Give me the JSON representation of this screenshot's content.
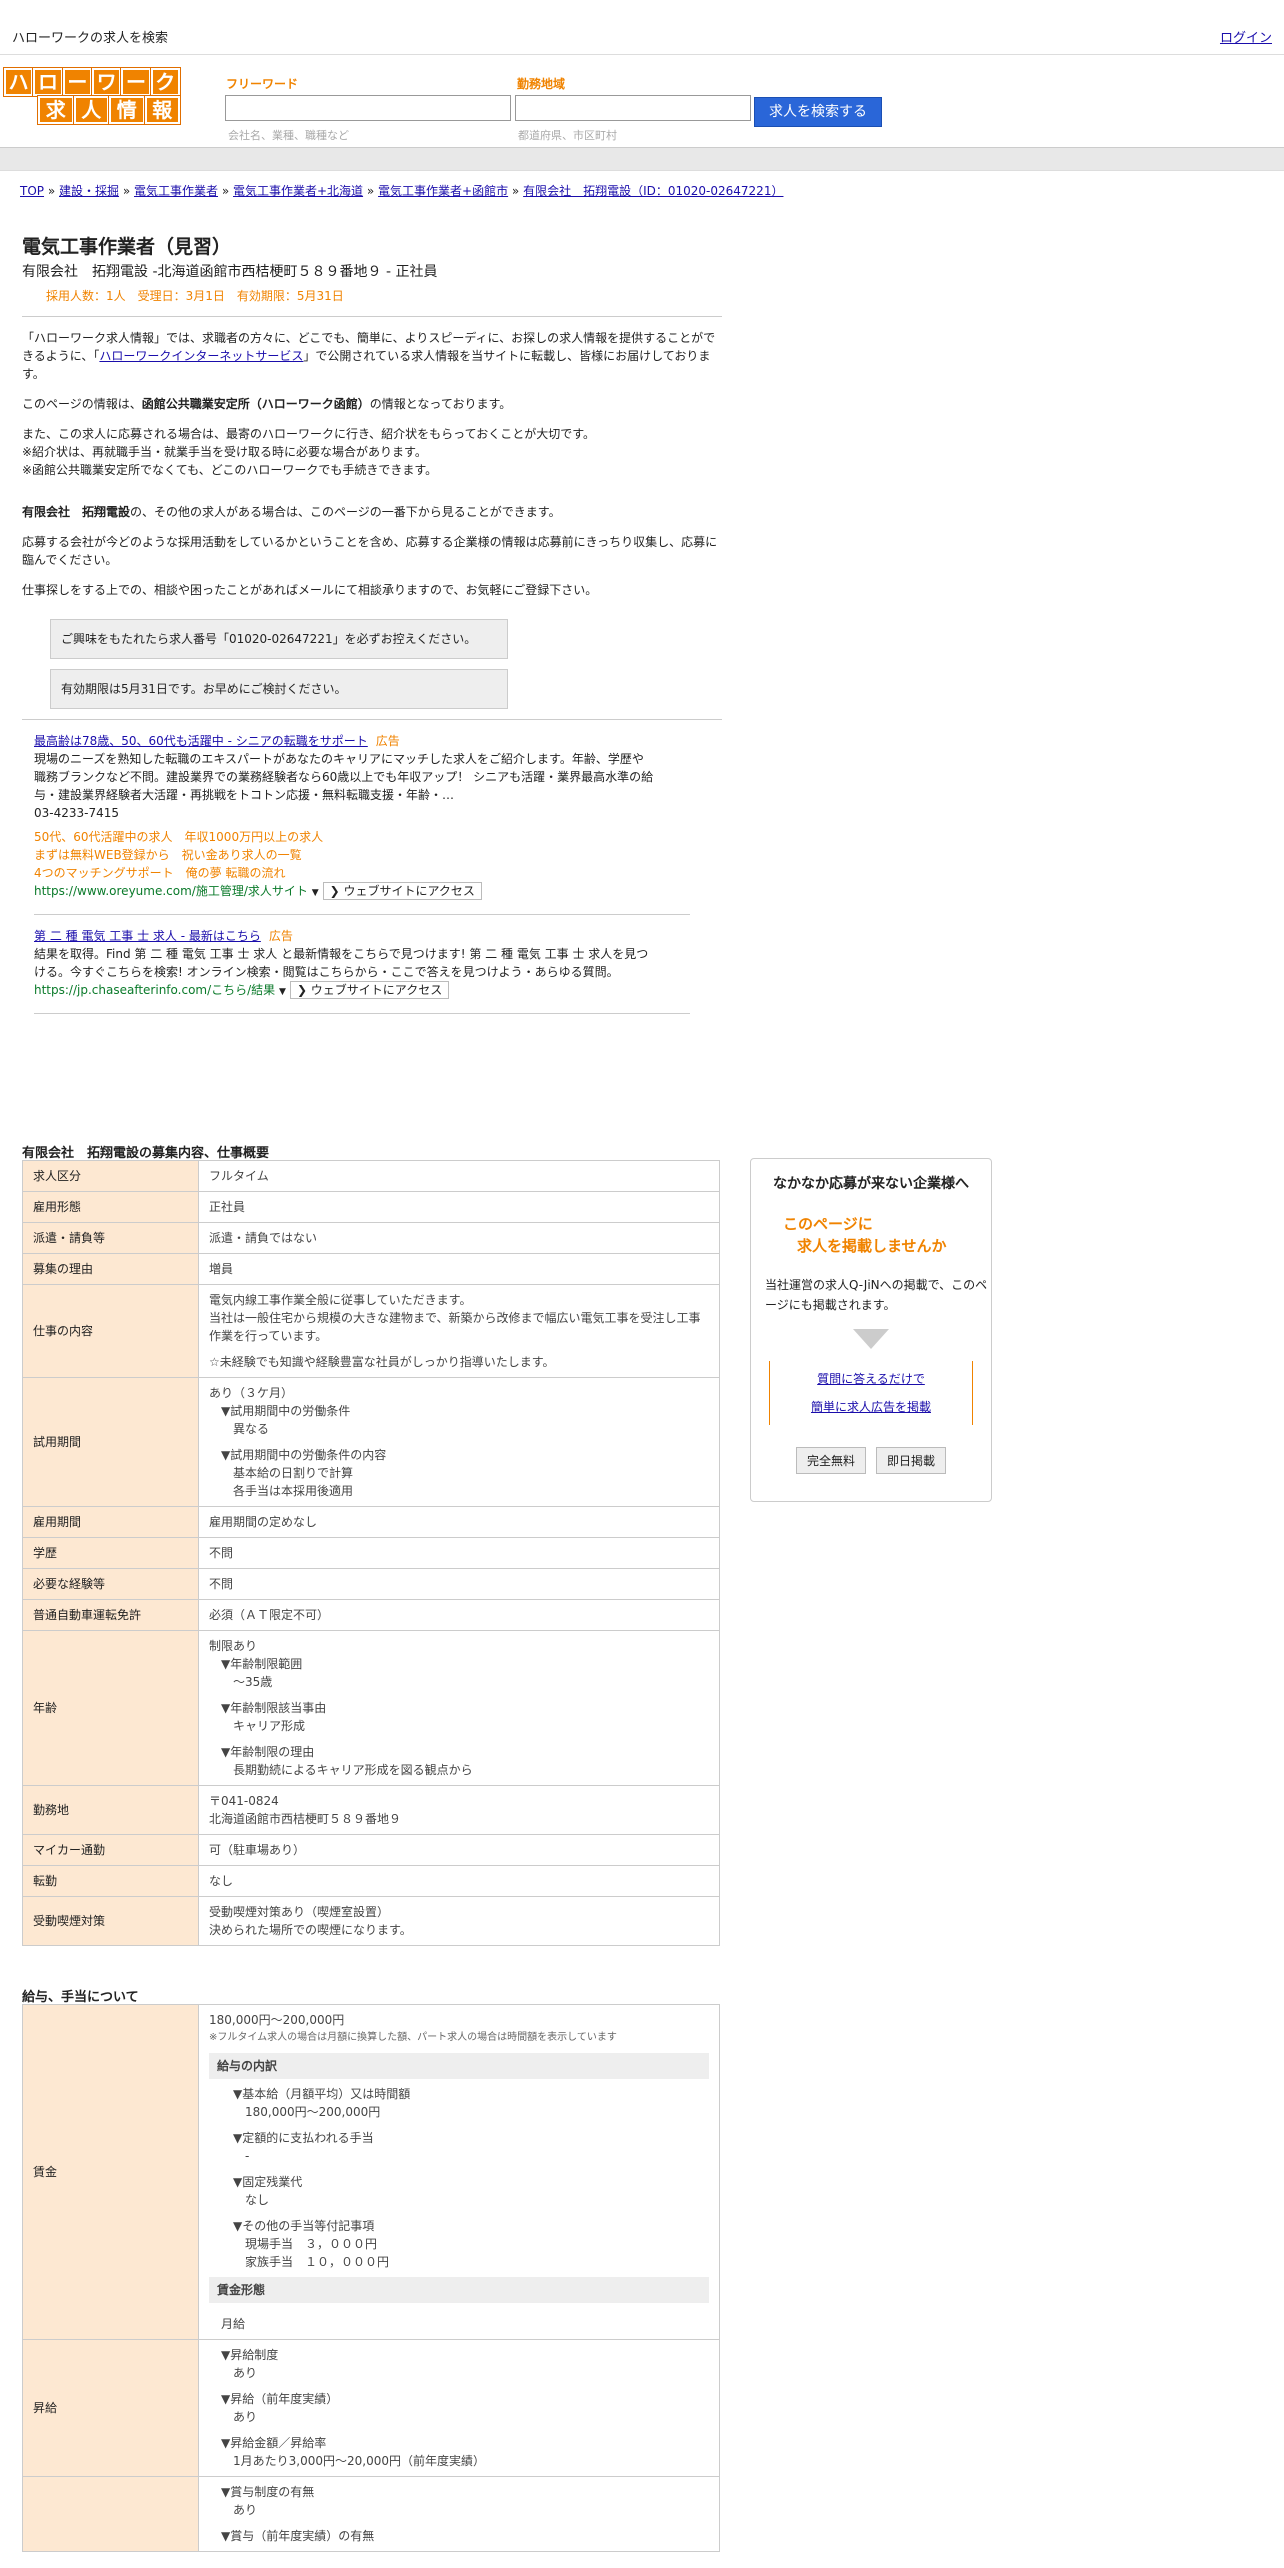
{
  "top": {
    "site_title": "ハローワークの求人を検索",
    "login": "ログイン"
  },
  "logo": {
    "row1": [
      "ハ",
      "ロ",
      "ー",
      "ワ",
      "ー",
      "ク"
    ],
    "row2": [
      "求",
      "人",
      "情",
      "報"
    ]
  },
  "search": {
    "keyword_label": "フリーワード",
    "keyword_hint": "会社名、業種、職種など",
    "area_label": "勤務地域",
    "area_hint": "都道府県、市区町村",
    "button": "求人を検索する"
  },
  "breadcrumb": [
    "TOP",
    "建設・採掘",
    "電気工事作業者",
    "電気工事作業者+北海道",
    "電気工事作業者+函館市",
    "有限会社　拓翔電設（ID：01020-02647221）"
  ],
  "job": {
    "title": "電気工事作業者（見習）",
    "subtitle": "有限会社　拓翔電設 -北海道函館市西桔梗町５８９番地９ - 正社員",
    "meta": "採用人数：1人　受理日：3月1日　有効期限：5月31日"
  },
  "intro": {
    "p1a": "「ハローワーク求人情報」では、求職者の方々に、どこでも、簡単に、よりスピーディに、お探しの求人情報を提供することができるように、「",
    "p1link": "ハローワークインターネットサービス",
    "p1b": "」で公開されている求人情報を当サイトに転載し、皆様にお届けしております。",
    "p2a": "このページの情報は、",
    "p2b": "函館公共職業安定所（ハローワーク函館）",
    "p2c": "の情報となっております。",
    "p3": "また、この求人に応募される場合は、最寄のハローワークに行き、紹介状をもらっておくことが大切です。",
    "p4": "※紹介状は、再就職手当・就業手当を受け取る時に必要な場合があります。",
    "p5": "※函館公共職業安定所でなくても、どこのハローワークでも手続きできます。",
    "p6a": "有限会社　拓翔電設",
    "p6b": "の、その他の求人がある場合は、このページの一番下から見ることができます。",
    "p7": "応募する会社が今どのような採用活動をしているかということを含め、応募する企業様の情報は応募前にきっちり収集し、応募に臨んでください。",
    "p8": "仕事探しをする上での、相談や困ったことがあればメールにて相談承りますので、お気軽にご登録下さい。",
    "notice1": "ご興味をもたれたら求人番号「01020-02647221」を必ずお控えください。",
    "notice2": "有効期限は5月31日です。お早めにご検討ください。"
  },
  "ads": [
    {
      "title": "最高齢は78歳、50、60代も活躍中 - シニアの転職をサポート",
      "tag": "広告",
      "desc": "現場のニーズを熟知した転職のエキスパートがあなたのキャリアにマッチした求人をご紹介します。年齢、学歴や職務ブランクなど不問。建設業界での業務経験者なら60歳以上でも年収アップ！ シニアも活躍・業界最高水準の給与・建設業界経験者大活躍・再挑戦をトコトン応援・無料転職支援・年齢・…",
      "phone": "03-4233-7415",
      "links": [
        "50代、60代活躍中の求人　年収1000万円以上の求人",
        "まずは無料WEB登録から　祝い金あり求人の一覧",
        "4つのマッチングサポート　俺の夢 転職の流れ"
      ],
      "url": "https://www.oreyume.com/施工管理/求人サイト",
      "visit": "❯ ウェブサイトにアクセス"
    },
    {
      "title": "第 二 種 電気 工事 士 求人 - 最新はこちら",
      "tag": "広告",
      "desc": "結果を取得。Find 第 二 種 電気 工事 士 求人 と最新情報をこちらで見つけます! 第 二 種 電気 工事 士 求人を見つける。今すぐこちらを検索! オンライン検索・閲覧はこちらから・ここで答えを見つけよう・あらゆる質問。",
      "url": "https://jp.chaseafterinfo.com/こちら/結果",
      "visit": "❯ ウェブサイトにアクセス"
    }
  ],
  "spec_title": "有限会社　拓翔電設の募集内容、仕事概要",
  "spec": [
    {
      "k": "求人区分",
      "v": [
        "フルタイム"
      ]
    },
    {
      "k": "雇用形態",
      "v": [
        "正社員"
      ]
    },
    {
      "k": "派遣・請負等",
      "v": [
        "派遣・請負ではない"
      ]
    },
    {
      "k": "募集の理由",
      "v": [
        "増員"
      ]
    },
    {
      "k": "仕事の内容",
      "v": [
        "電気内線工事作業全般に従事していただきます。",
        "当社は一般住宅から規模の大きな建物まで、新築から改修まで幅広い電気工事を受注し工事作業を行っています。",
        "",
        "☆未経験でも知識や経験豊富な社員がしっかり指導いたします。"
      ]
    },
    {
      "k": "試用期間",
      "v": [
        "あり（３ケ月）",
        "▼試用期間中の労働条件",
        "異なる",
        "",
        "▼試用期間中の労働条件の内容",
        "基本給の日割りで計算",
        "各手当は本採用後適用"
      ]
    },
    {
      "k": "雇用期間",
      "v": [
        "雇用期間の定めなし"
      ]
    },
    {
      "k": "学歴",
      "v": [
        "不問"
      ]
    },
    {
      "k": "必要な経験等",
      "v": [
        "不問"
      ]
    },
    {
      "k": "普通自動車運転免許",
      "v": [
        "必須（ＡＴ限定不可）"
      ]
    },
    {
      "k": "年齢",
      "v": [
        "制限あり",
        "▼年齢制限範囲",
        "〜35歳",
        "",
        "▼年齢制限該当事由",
        "キャリア形成",
        "",
        "▼年齢制限の理由",
        "長期勤続によるキャリア形成を図る観点から"
      ]
    },
    {
      "k": "勤務地",
      "v": [
        "〒041-0824",
        "北海道函館市西桔梗町５８９番地９"
      ]
    },
    {
      "k": "マイカー通勤",
      "v": [
        "可（駐車場あり）"
      ]
    },
    {
      "k": "転勤",
      "v": [
        "なし"
      ]
    },
    {
      "k": "受動喫煙対策",
      "v": [
        "受動喫煙対策あり（喫煙室設置）",
        "決められた場所での喫煙になります。"
      ]
    }
  ],
  "pay_title": "給与、手当について",
  "pay": {
    "wage_label": "賃金",
    "wage_range": "180,000円〜200,000円",
    "wage_note": "※フルタイム求人の場合は月額に換算した額、パート求人の場合は時間額を表示しています",
    "breakdown_title": "給与の内訳",
    "items": [
      "▼基本給（月額平均）又は時間額",
      "180,000円〜200,000円",
      "",
      "▼定額的に支払われる手当",
      "-",
      "",
      "▼固定残業代",
      "なし",
      "",
      "▼その他の手当等付記事項",
      "現場手当　３，０００円",
      "家族手当　１０，０００円"
    ],
    "form_title": "賃金形態",
    "form_value": "月給",
    "raise_label": "昇給",
    "raise": [
      "▼昇給制度",
      "あり",
      "",
      "▼昇給（前年度実績）",
      "あり",
      "",
      "▼昇給金額／昇給率",
      "1月あたり3,000円〜20,000円（前年度実績）"
    ],
    "bonus_items": [
      "▼賞与制度の有無",
      "あり",
      "",
      "▼賞与（前年度実績）の有無"
    ]
  },
  "side": {
    "heading": "なかなか応募が来ない企業様へ",
    "catch1": "このページに",
    "catch2": "求人を掲載しませんか",
    "desc": "当社運営の求人Q-JiNへの掲載で、このページにも掲載されます。",
    "link1": "質問に答えるだけで",
    "link2": "簡単に求人広告を掲載",
    "btn1": "完全無料",
    "btn2": "即日掲載"
  }
}
